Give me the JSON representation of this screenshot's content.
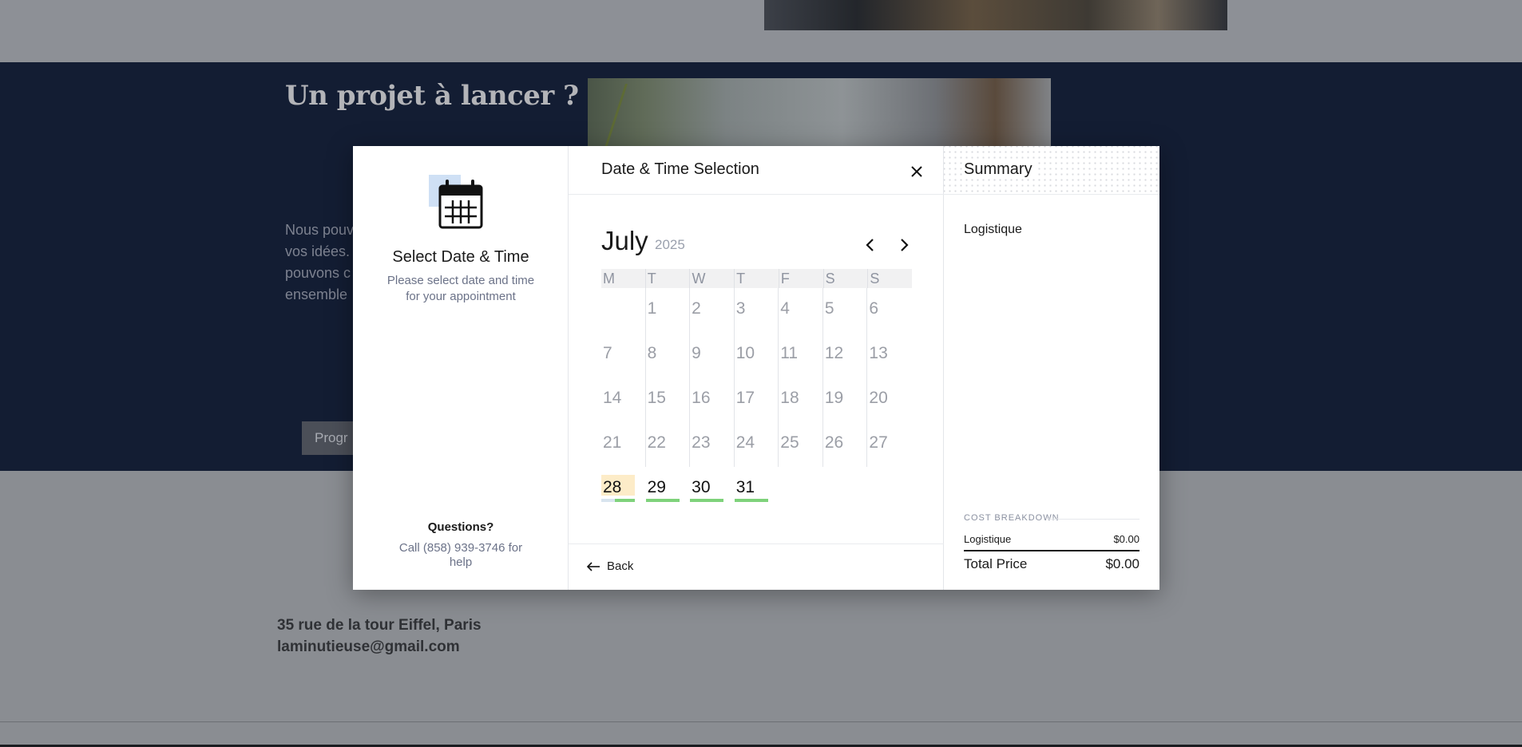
{
  "background": {
    "title": "Un projet à lancer ?",
    "paragraph_lines": [
      "Nous pouv",
      "vos idées.",
      "pouvons c",
      "ensemble"
    ],
    "button_label": "Progr",
    "address": "35 rue de la tour Eiffel, Paris",
    "email": "laminutieuse@gmail.com"
  },
  "left_panel": {
    "icon": "calendar-icon",
    "title": "Select Date & Time",
    "subtitle": "Please select date and time for your appointment",
    "questions_title": "Questions?",
    "questions_text": "Call (858) 939-3746 for help"
  },
  "middle_panel": {
    "title": "Date & Time Selection",
    "month": "July",
    "year": "2025",
    "weekdays": [
      "M",
      "T",
      "W",
      "T",
      "F",
      "S",
      "S"
    ],
    "days": [
      {
        "label": "",
        "state": "empty"
      },
      {
        "label": "1",
        "state": "past"
      },
      {
        "label": "2",
        "state": "past"
      },
      {
        "label": "3",
        "state": "past"
      },
      {
        "label": "4",
        "state": "past"
      },
      {
        "label": "5",
        "state": "past"
      },
      {
        "label": "6",
        "state": "past"
      },
      {
        "label": "7",
        "state": "past"
      },
      {
        "label": "8",
        "state": "past"
      },
      {
        "label": "9",
        "state": "past"
      },
      {
        "label": "10",
        "state": "past"
      },
      {
        "label": "11",
        "state": "past"
      },
      {
        "label": "12",
        "state": "past"
      },
      {
        "label": "13",
        "state": "past"
      },
      {
        "label": "14",
        "state": "past"
      },
      {
        "label": "15",
        "state": "past"
      },
      {
        "label": "16",
        "state": "past"
      },
      {
        "label": "17",
        "state": "past"
      },
      {
        "label": "18",
        "state": "past"
      },
      {
        "label": "19",
        "state": "past"
      },
      {
        "label": "20",
        "state": "past"
      },
      {
        "label": "21",
        "state": "past"
      },
      {
        "label": "22",
        "state": "past"
      },
      {
        "label": "23",
        "state": "past"
      },
      {
        "label": "24",
        "state": "past"
      },
      {
        "label": "25",
        "state": "past"
      },
      {
        "label": "26",
        "state": "past"
      },
      {
        "label": "27",
        "state": "past"
      },
      {
        "label": "28",
        "state": "today"
      },
      {
        "label": "29",
        "state": "available"
      },
      {
        "label": "30",
        "state": "available"
      },
      {
        "label": "31",
        "state": "available"
      }
    ],
    "back_label": "Back"
  },
  "right_panel": {
    "title": "Summary",
    "service": "Logistique",
    "cost_breakdown_label": "COST BREAKDOWN",
    "cost_item_label": "Logistique",
    "cost_item_value": "$0.00",
    "total_label": "Total Price",
    "total_value": "$0.00"
  },
  "colors": {
    "accent_available": "#7fd27b",
    "today_highlight": "#fdecc8",
    "navy_section": "#131d33"
  }
}
